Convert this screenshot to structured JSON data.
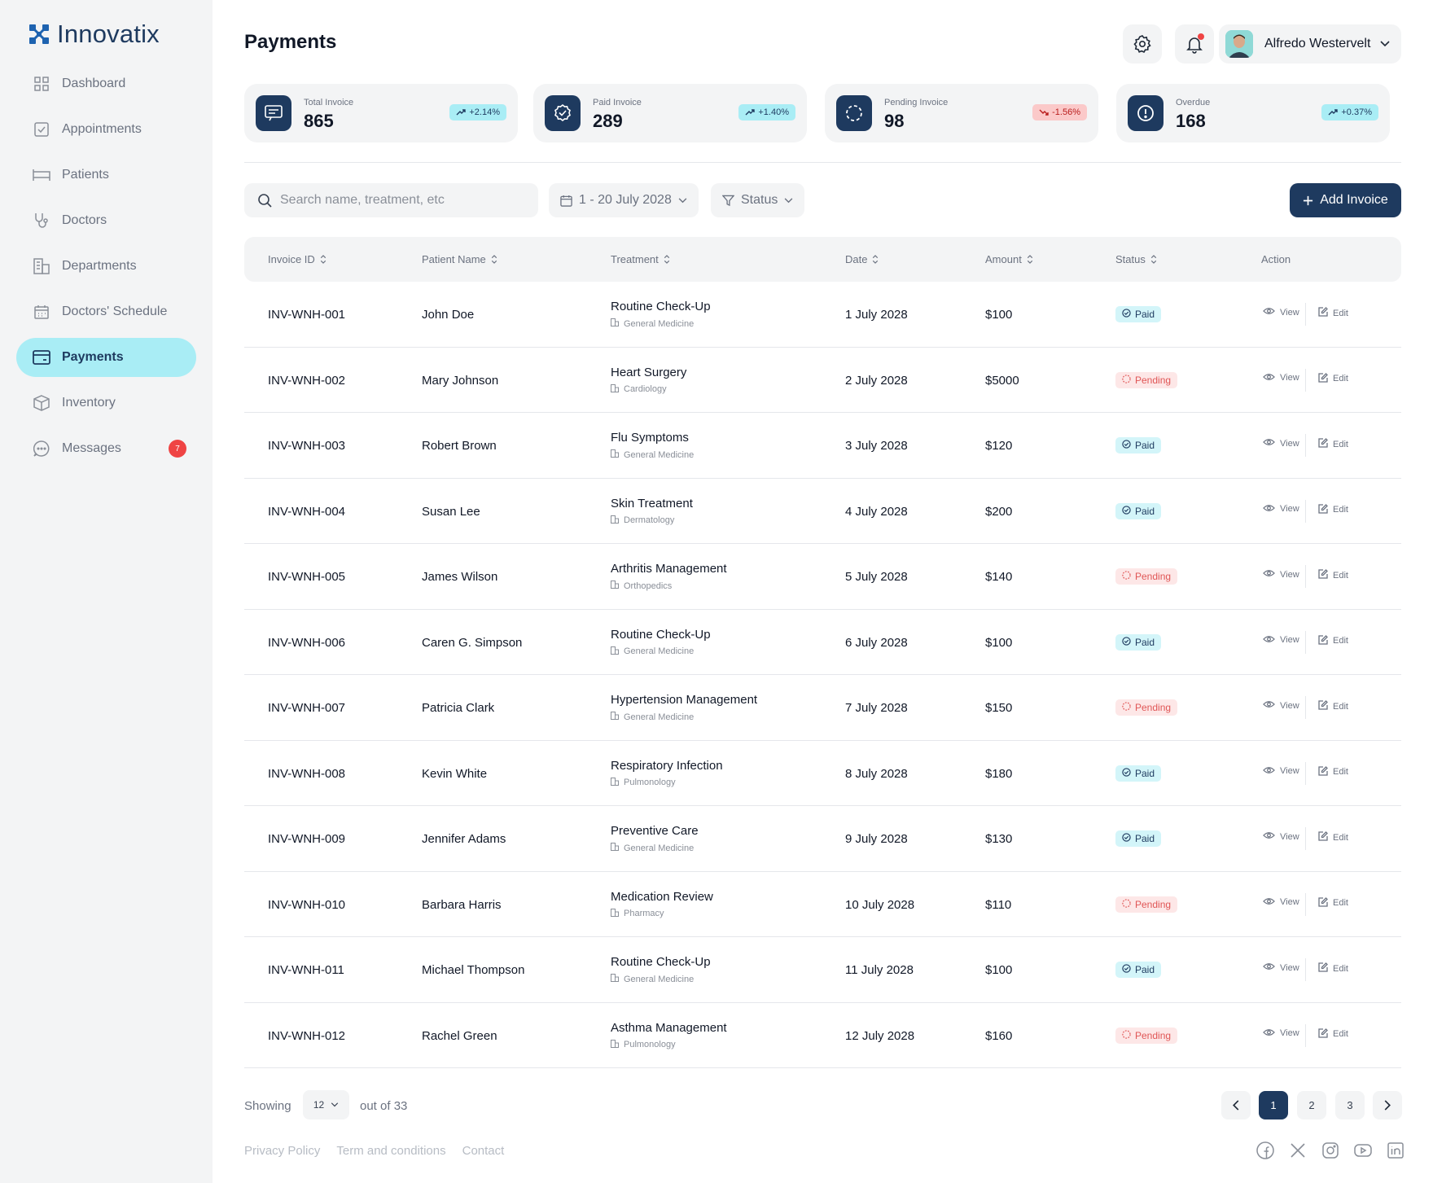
{
  "app": {
    "logo_text": "Innovatix",
    "page_title": "Payments",
    "colors": {
      "primary": "#1e3a5f",
      "accent": "#a9edf5",
      "danger": "#ef4444"
    }
  },
  "sidebar": {
    "items": [
      {
        "label": "Dashboard",
        "icon": "dashboard-grid-icon"
      },
      {
        "label": "Appointments",
        "icon": "checkbox-icon"
      },
      {
        "label": "Patients",
        "icon": "bed-icon"
      },
      {
        "label": "Doctors",
        "icon": "stethoscope-icon"
      },
      {
        "label": "Departments",
        "icon": "building-icon"
      },
      {
        "label": "Doctors' Schedule",
        "icon": "calendar-icon"
      },
      {
        "label": "Payments",
        "icon": "wallet-icon",
        "active": true
      },
      {
        "label": "Inventory",
        "icon": "box-icon"
      },
      {
        "label": "Messages",
        "icon": "chat-icon",
        "badge": "7"
      }
    ]
  },
  "header": {
    "user_name": "Alfredo Westervelt"
  },
  "stats": [
    {
      "label": "Total Invoice",
      "value": "865",
      "change": "+2.14%",
      "trend": "up",
      "icon": "invoice-icon"
    },
    {
      "label": "Paid Invoice",
      "value": "289",
      "change": "+1.40%",
      "trend": "up",
      "icon": "verified-badge-icon"
    },
    {
      "label": "Pending Invoice",
      "value": "98",
      "change": "-1.56%",
      "trend": "down",
      "icon": "loading-circle-icon"
    },
    {
      "label": "Overdue",
      "value": "168",
      "change": "+0.37%",
      "trend": "up",
      "icon": "alert-circle-icon"
    }
  ],
  "toolbar": {
    "search_placeholder": "Search name, treatment, etc",
    "date_range": "1 - 20 July 2028",
    "status_filter": "Status",
    "add_label": "Add Invoice"
  },
  "table": {
    "columns": [
      "Invoice ID",
      "Patient Name",
      "Treatment",
      "Date",
      "Amount",
      "Status",
      "Action"
    ],
    "view_label": "View",
    "edit_label": "Edit",
    "rows": [
      {
        "id": "INV-WNH-001",
        "patient": "John Doe",
        "treatment": "Routine Check-Up",
        "dept": "General Medicine",
        "date": "1 July 2028",
        "amount": "$100",
        "status": "Paid"
      },
      {
        "id": "INV-WNH-002",
        "patient": "Mary Johnson",
        "treatment": "Heart Surgery",
        "dept": "Cardiology",
        "date": "2 July 2028",
        "amount": "$5000",
        "status": "Pending"
      },
      {
        "id": "INV-WNH-003",
        "patient": "Robert Brown",
        "treatment": "Flu Symptoms",
        "dept": "General Medicine",
        "date": "3 July 2028",
        "amount": "$120",
        "status": "Paid"
      },
      {
        "id": "INV-WNH-004",
        "patient": "Susan Lee",
        "treatment": "Skin Treatment",
        "dept": "Dermatology",
        "date": "4 July 2028",
        "amount": "$200",
        "status": "Paid"
      },
      {
        "id": "INV-WNH-005",
        "patient": "James Wilson",
        "treatment": "Arthritis Management",
        "dept": "Orthopedics",
        "date": "5 July 2028",
        "amount": "$140",
        "status": "Pending"
      },
      {
        "id": "INV-WNH-006",
        "patient": "Caren G. Simpson",
        "treatment": "Routine Check-Up",
        "dept": "General Medicine",
        "date": "6 July 2028",
        "amount": "$100",
        "status": "Paid"
      },
      {
        "id": "INV-WNH-007",
        "patient": "Patricia Clark",
        "treatment": "Hypertension Management",
        "dept": "General Medicine",
        "date": "7 July 2028",
        "amount": "$150",
        "status": "Pending"
      },
      {
        "id": "INV-WNH-008",
        "patient": "Kevin White",
        "treatment": "Respiratory Infection",
        "dept": "Pulmonology",
        "date": "8 July 2028",
        "amount": "$180",
        "status": "Paid"
      },
      {
        "id": "INV-WNH-009",
        "patient": "Jennifer Adams",
        "treatment": "Preventive Care",
        "dept": "General Medicine",
        "date": "9 July 2028",
        "amount": "$130",
        "status": "Paid"
      },
      {
        "id": "INV-WNH-010",
        "patient": "Barbara Harris",
        "treatment": "Medication Review",
        "dept": "Pharmacy",
        "date": "10 July 2028",
        "amount": "$110",
        "status": "Pending"
      },
      {
        "id": "INV-WNH-011",
        "patient": "Michael Thompson",
        "treatment": "Routine Check-Up",
        "dept": "General Medicine",
        "date": "11 July 2028",
        "amount": "$100",
        "status": "Paid"
      },
      {
        "id": "INV-WNH-012",
        "patient": "Rachel Green",
        "treatment": "Asthma Management",
        "dept": "Pulmonology",
        "date": "12 July 2028",
        "amount": "$160",
        "status": "Pending"
      }
    ]
  },
  "pagination": {
    "showing_label": "Showing",
    "per_page": "12",
    "out_of": "out of 33",
    "pages": [
      "1",
      "2",
      "3"
    ],
    "current": "1"
  },
  "footer": {
    "links": [
      "Privacy Policy",
      "Term and conditions",
      "Contact"
    ],
    "socials": [
      "facebook-icon",
      "x-twitter-icon",
      "instagram-icon",
      "youtube-icon",
      "linkedin-icon"
    ]
  }
}
